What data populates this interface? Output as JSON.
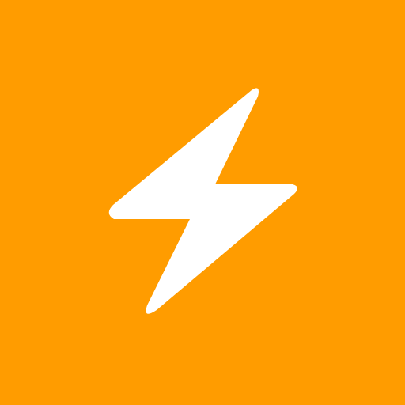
{
  "icon": {
    "name": "lightning-bolt-icon",
    "background_color": "#FF9C00",
    "glyph_color": "#FFFFFF"
  }
}
